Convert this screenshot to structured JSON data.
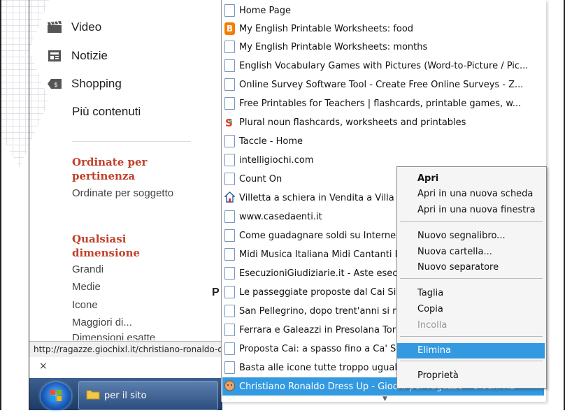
{
  "sidebar": {
    "items": [
      {
        "label": "Video",
        "icon": "clapperboard-icon"
      },
      {
        "label": "Notizie",
        "icon": "newspaper-icon"
      },
      {
        "label": "Shopping",
        "icon": "price-tag-icon"
      }
    ],
    "more_label": "Più contenuti",
    "sort": {
      "heading": "Ordinate per pertinenza",
      "option": "Ordinate per soggetto"
    },
    "size": {
      "heading": "Qualsiasi dimensione",
      "options": [
        "Grandi",
        "Medie",
        "Icone",
        "Maggiori di...",
        "Dimensioni esatte"
      ]
    }
  },
  "status": {
    "url": "http://ragazze.giochixl.it/christiano-ronaldo-dress-up.html",
    "close_glyph": "×",
    "partial_letter": "P"
  },
  "taskbar": {
    "folder_label": "per il sito"
  },
  "bookmarks": [
    {
      "label": "Home Page",
      "icon": "page"
    },
    {
      "label": "My English Printable Worksheets: food",
      "icon": "blog"
    },
    {
      "label": "My English Printable Worksheets: months",
      "icon": "page"
    },
    {
      "label": "English Vocabulary Games with Pictures (Word-to-Picture / Pic...",
      "icon": "page"
    },
    {
      "label": "Online Survey Software Tool - Create Free Online Surveys - Z...",
      "icon": "page"
    },
    {
      "label": "Free Printables for Teachers | flashcards, printable games, w...",
      "icon": "page"
    },
    {
      "label": "Plural noun flashcards, worksheets and printables",
      "icon": "colorful"
    },
    {
      "label": "Taccle - Home",
      "icon": "page"
    },
    {
      "label": "intelligiochi.com",
      "icon": "page"
    },
    {
      "label": "Count On",
      "icon": "page"
    },
    {
      "label": "Villetta a schiera in Vendita a Villa D",
      "icon": "house"
    },
    {
      "label": "www.casedaenti.it",
      "icon": "page"
    },
    {
      "label": "Come guadagnare soldi su Interne",
      "icon": "page"
    },
    {
      "label": "Midi Musica Italiana Midi Cantanti It",
      "icon": "page"
    },
    {
      "label": "EsecuzioniGiudiziarie.it - Aste esecu",
      "icon": "page"
    },
    {
      "label": "Le passeggiate proposte dal Cai Si",
      "icon": "page"
    },
    {
      "label": "San Pellegrino, dopo trent'anni si ri",
      "icon": "page"
    },
    {
      "label": "Ferrara e Galeazzi in Presolana Tor",
      "icon": "page"
    },
    {
      "label": "Proposta Cai: a spasso fino a Ca' S",
      "icon": "page"
    },
    {
      "label": "Basta alle icone tutte troppo ugual",
      "icon": "page"
    },
    {
      "label": "Christiano Ronaldo Dress Up - Giochi per ragazze - Giochi XL",
      "icon": "game"
    }
  ],
  "context_menu": [
    {
      "label": "Apri",
      "style": "bold"
    },
    {
      "label": "Apri in una nuova scheda",
      "style": "normal"
    },
    {
      "label": "Apri in una nuova finestra",
      "style": "normal"
    },
    {
      "label": "Nuovo segnalibro...",
      "style": "normal"
    },
    {
      "label": "Nuova cartella...",
      "style": "normal"
    },
    {
      "label": "Nuovo separatore",
      "style": "normal"
    },
    {
      "label": "Taglia",
      "style": "normal"
    },
    {
      "label": "Copia",
      "style": "normal"
    },
    {
      "label": "Incolla",
      "style": "disabled"
    },
    {
      "label": "Elimina",
      "style": "highlight"
    },
    {
      "label": "Proprietà",
      "style": "normal"
    }
  ],
  "colors": {
    "highlight": "#3399e0",
    "filter_heading": "#c1402b",
    "taskbar": "#1d3a63"
  }
}
